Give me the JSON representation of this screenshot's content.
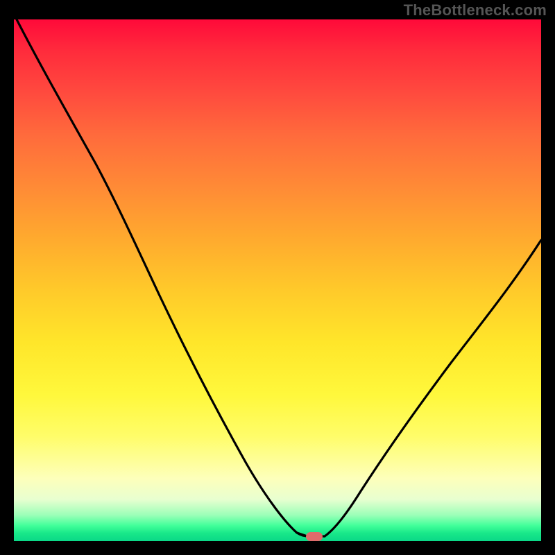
{
  "watermark": "TheBottleneck.com",
  "chart_data": {
    "type": "line",
    "title": "",
    "xlabel": "",
    "ylabel": "",
    "xlim": [
      0,
      100
    ],
    "ylim": [
      0,
      100
    ],
    "grid": false,
    "legend": false,
    "series": [
      {
        "name": "bottleneck-curve",
        "x": [
          0,
          6,
          12,
          18,
          24,
          30,
          36,
          42,
          48,
          52,
          55,
          56,
          57,
          58,
          60,
          64,
          70,
          78,
          88,
          100
        ],
        "y": [
          100,
          91,
          82,
          72,
          62,
          50,
          38,
          26,
          14,
          6,
          1,
          0,
          0,
          0.5,
          2,
          8,
          18,
          30,
          43,
          58
        ]
      }
    ],
    "marker": {
      "shape": "rounded-rect",
      "x": 56.5,
      "y": 0,
      "color": "#e06a6a"
    },
    "background_gradient": {
      "top": "#ff0a3a",
      "upper_mid": "#ffaa2e",
      "mid": "#ffe62a",
      "lower_mid": "#fdffbb",
      "bottom": "#18e889"
    }
  }
}
